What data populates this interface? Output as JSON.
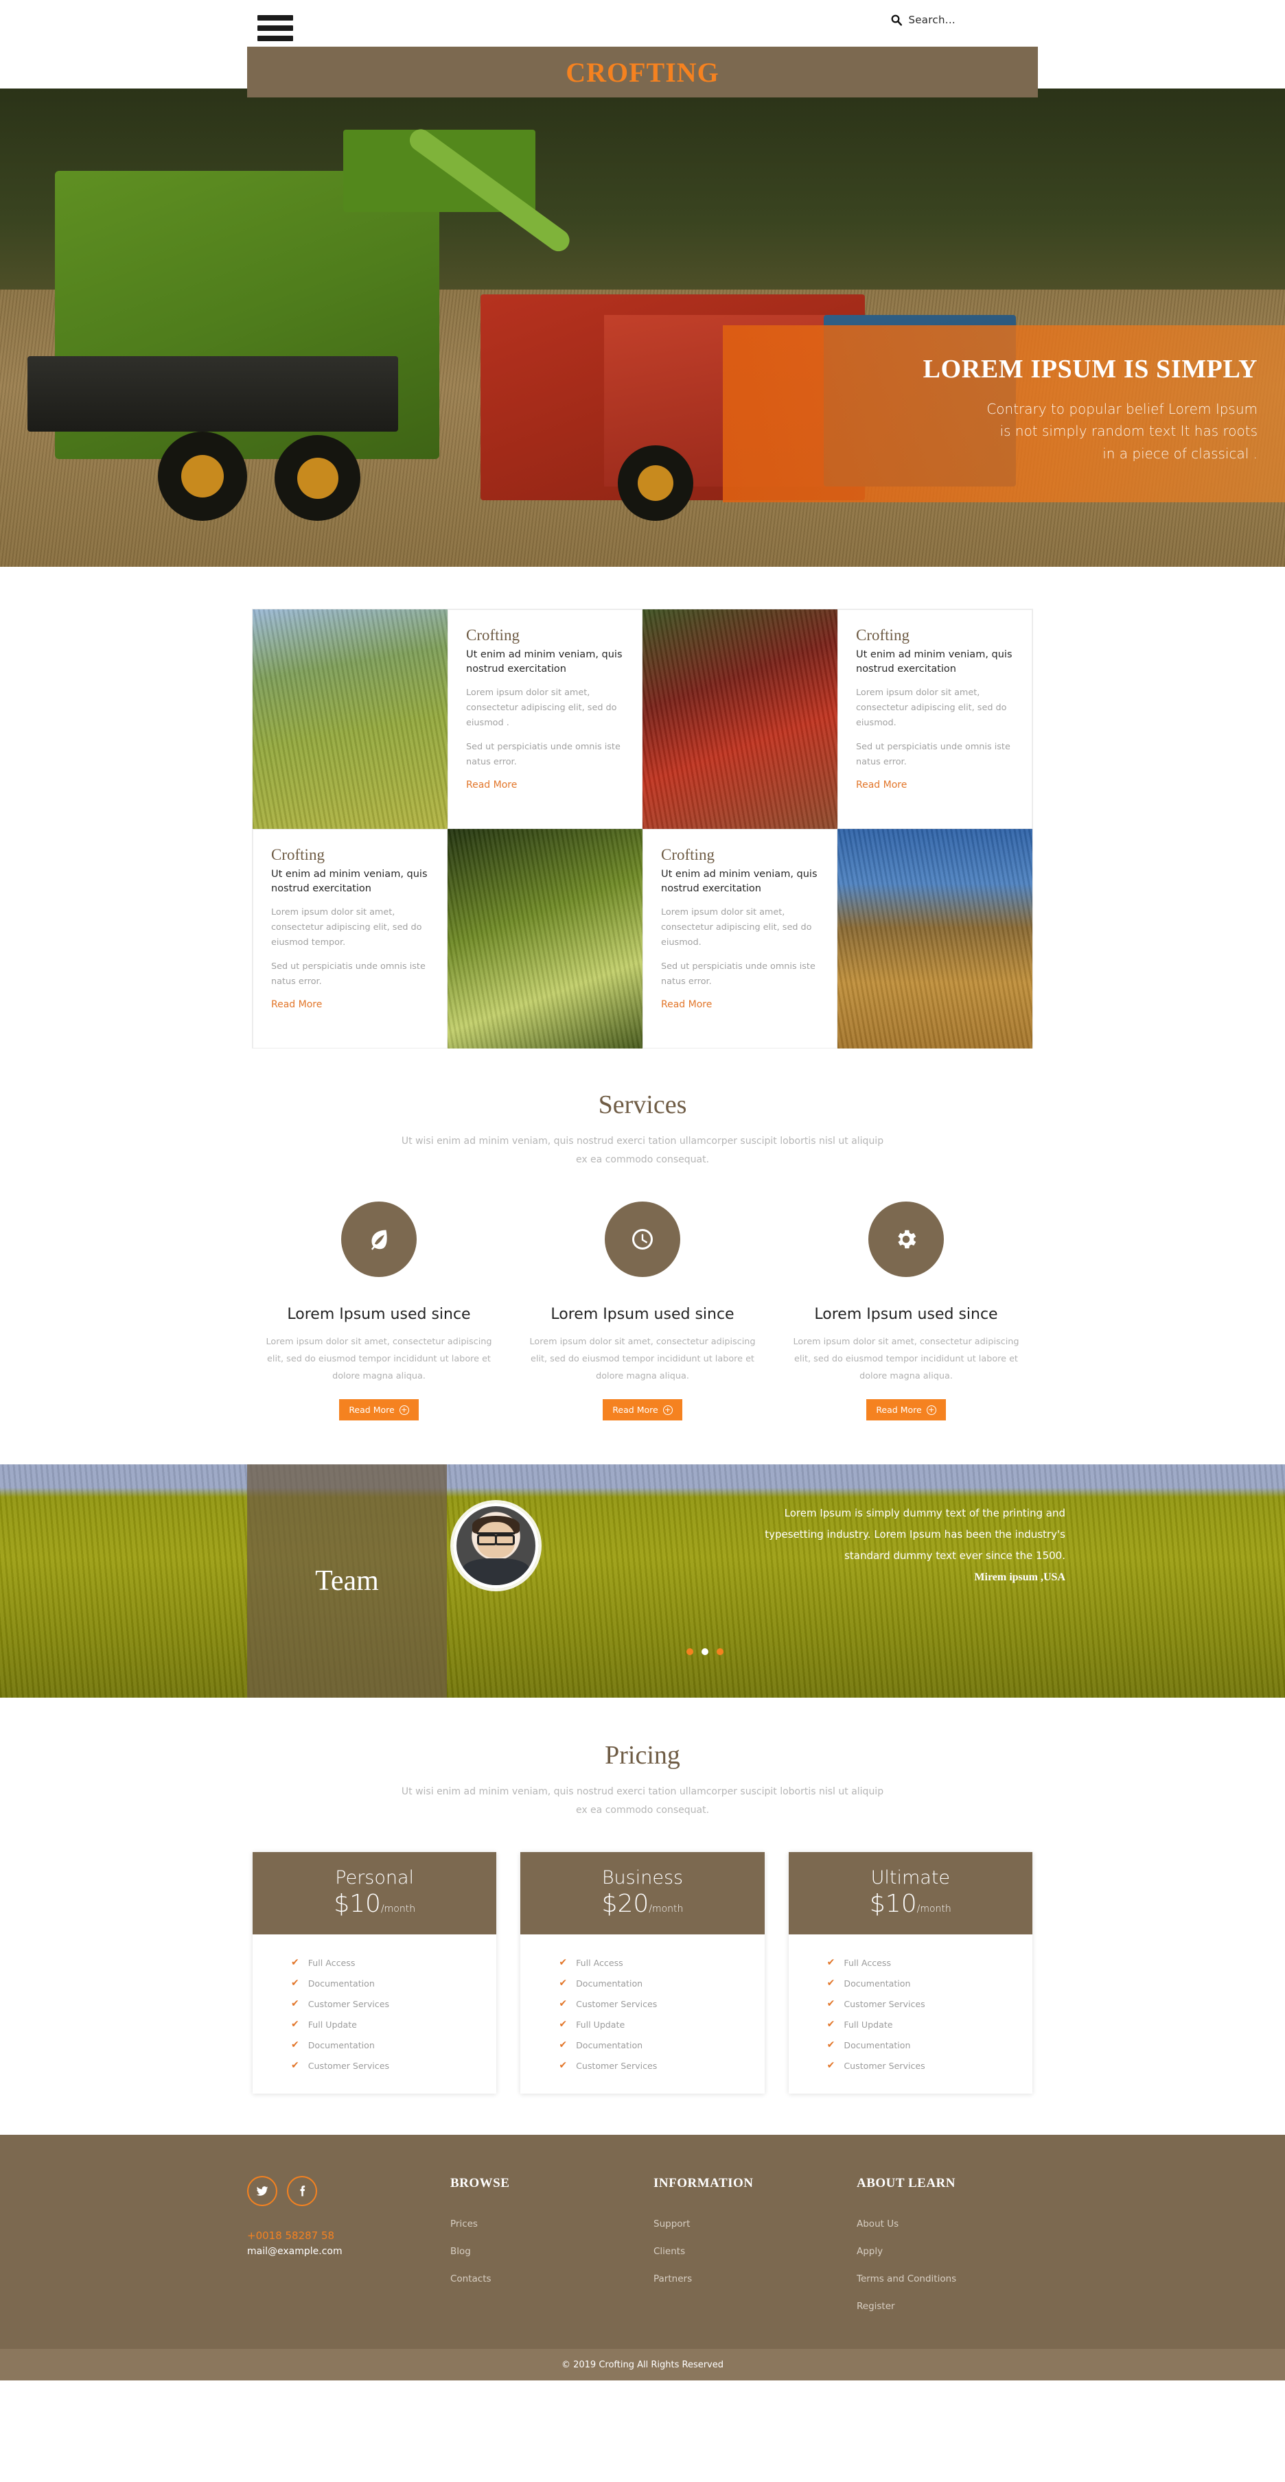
{
  "header": {
    "menu_icon": "hamburger-icon",
    "search_icon": "search-icon",
    "search_placeholder": "Search...",
    "logo": "CROFTING"
  },
  "hero": {
    "title": "LOREM IPSUM IS SIMPLY",
    "line1": "Contrary to popular belief Lorem Ipsum",
    "line2": "is not simply random text It has roots",
    "line3": "in a piece of classical ."
  },
  "cards": [
    {
      "title": "Crofting",
      "lead": "Ut enim ad minim veniam, quis nostrud exercitation",
      "body1": "Lorem ipsum dolor sit amet, consectetur adipiscing elit, sed do eiusmod .",
      "body2": "Sed ut perspiciatis unde omnis iste natus error.",
      "more": "Read More",
      "image": "wheat-field-image"
    },
    {
      "title": "Crofting",
      "lead": "Ut enim ad minim veniam, quis nostrud exercitation",
      "body1": "Lorem ipsum dolor sit amet, consectetur adipiscing elit, sed do eiusmod.",
      "body2": "Sed ut perspiciatis unde omnis iste natus error.",
      "more": "Read More",
      "image": "strawberry-image"
    },
    {
      "title": "Crofting",
      "lead": "Ut enim ad minim veniam, quis nostrud exercitation",
      "body1": "Lorem ipsum dolor sit amet, consectetur adipiscing elit, sed do eiusmod tempor.",
      "body2": "Sed ut perspiciatis unde omnis iste natus error.",
      "more": "Read More",
      "image": "green-tomato-image"
    },
    {
      "title": "Crofting",
      "lead": "Ut enim ad minim veniam, quis nostrud exercitation",
      "body1": "Lorem ipsum dolor sit amet, consectetur adipiscing elit, sed do eiusmod.",
      "body2": "Sed ut perspiciatis unde omnis iste natus error.",
      "more": "Read More",
      "image": "hay-bale-image"
    }
  ],
  "services": {
    "title": "Services",
    "subtitle": "Ut wisi enim ad minim veniam, quis nostrud exerci tation ullamcorper suscipit lobortis nisl ut aliquip ex ea commodo consequat.",
    "items": [
      {
        "icon": "leaf-icon",
        "heading": "Lorem Ipsum used since",
        "text": "Lorem ipsum dolor sit amet, consectetur adipiscing elit, sed do eiusmod tempor incididunt ut labore et dolore magna aliqua.",
        "button": "Read More"
      },
      {
        "icon": "clock-icon",
        "heading": "Lorem Ipsum used since",
        "text": "Lorem ipsum dolor sit amet, consectetur adipiscing elit, sed do eiusmod tempor incididunt ut labore et dolore magna aliqua.",
        "button": "Read More"
      },
      {
        "icon": "gear-icon",
        "heading": "Lorem Ipsum used since",
        "text": "Lorem ipsum dolor sit amet, consectetur adipiscing elit, sed do eiusmod tempor incididunt ut labore et dolore magna aliqua.",
        "button": "Read More"
      }
    ]
  },
  "team": {
    "label": "Team",
    "avatar": "team-member-avatar",
    "quote_line1": "Lorem Ipsum is simply dummy text of the printing and",
    "quote_line2": "typesetting industry. Lorem Ipsum has been the industry's",
    "quote_line3": "standard dummy text ever since the 1500.",
    "author": "Mirem ipsum ,USA",
    "slides": [
      {
        "active": false
      },
      {
        "active": true
      },
      {
        "active": false
      }
    ]
  },
  "pricing": {
    "title": "Pricing",
    "subtitle": "Ut wisi enim ad minim veniam, quis nostrud exerci tation ullamcorper suscipit lobortis nisl ut aliquip ex ea commodo consequat.",
    "plans": [
      {
        "name": "Personal",
        "price": "$10",
        "period": "/month",
        "features": [
          "Full Access",
          "Documentation",
          "Customer Services",
          "Full Update",
          "Documentation",
          "Customer Services"
        ]
      },
      {
        "name": "Business",
        "price": "$20",
        "period": "/month",
        "features": [
          "Full Access",
          "Documentation",
          "Customer Services",
          "Full Update",
          "Documentation",
          "Customer Services"
        ]
      },
      {
        "name": "Ultimate",
        "price": "$10",
        "period": "/month",
        "features": [
          "Full Access",
          "Documentation",
          "Customer Services",
          "Full Update",
          "Documentation",
          "Customer Services"
        ]
      }
    ]
  },
  "footer": {
    "social": [
      {
        "icon": "twitter-icon"
      },
      {
        "icon": "facebook-icon"
      }
    ],
    "phone": "+0018 58287 58",
    "email": "mail@example.com",
    "columns": [
      {
        "heading": "BROWSE",
        "links": [
          "Prices",
          "Blog",
          "Contacts"
        ]
      },
      {
        "heading": "INFORMATION",
        "links": [
          "Support",
          "Clients",
          "Partners"
        ]
      },
      {
        "heading": "ABOUT LEARN",
        "links": [
          "About Us",
          "Apply",
          "Terms and Conditions",
          "Register"
        ]
      }
    ],
    "copyright": "© 2019 Crofting All Rights Reserved"
  },
  "colors": {
    "brand_brown": "#7c6950",
    "accent_orange": "#f58220",
    "link_orange": "#e2762a",
    "copy_bar": "#8b775d"
  }
}
